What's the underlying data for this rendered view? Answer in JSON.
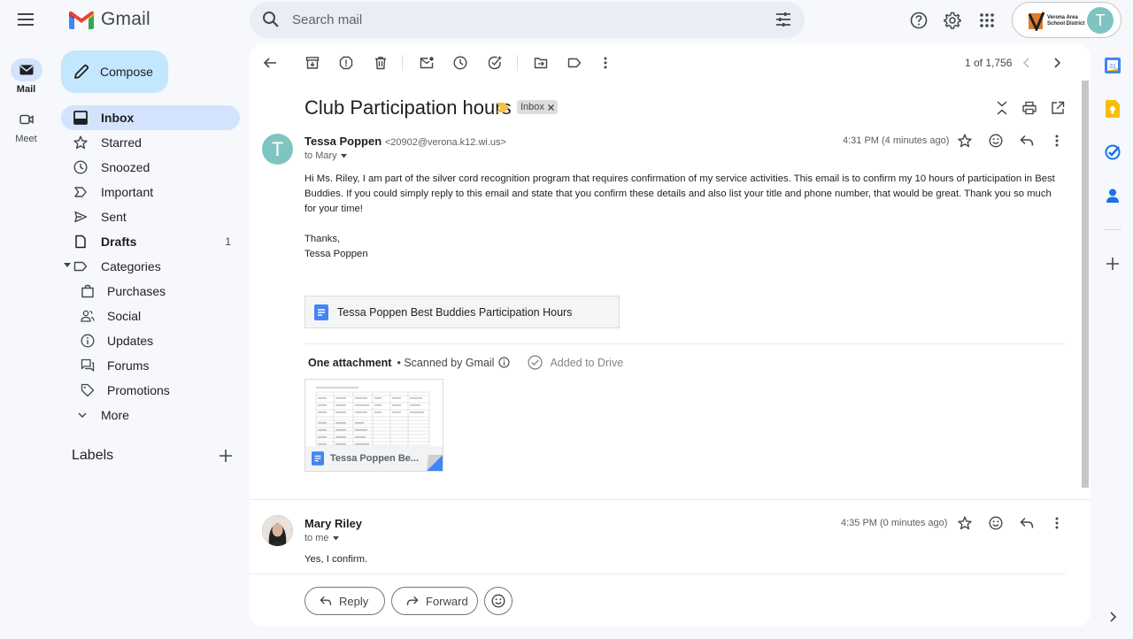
{
  "app": {
    "name": "Gmail"
  },
  "rail": {
    "mail_label": "Mail",
    "meet_label": "Meet"
  },
  "compose": {
    "label": "Compose"
  },
  "search": {
    "placeholder": "Search mail"
  },
  "account": {
    "org_name_line1": "Verona Area",
    "org_name_line2": "School District",
    "initial": "T"
  },
  "nav": {
    "items": [
      {
        "label": "Inbox",
        "count": ""
      },
      {
        "label": "Starred",
        "count": ""
      },
      {
        "label": "Snoozed",
        "count": ""
      },
      {
        "label": "Important",
        "count": ""
      },
      {
        "label": "Sent",
        "count": ""
      },
      {
        "label": "Drafts",
        "count": "1"
      },
      {
        "label": "Categories",
        "count": ""
      },
      {
        "label": "Purchases",
        "count": ""
      },
      {
        "label": "Social",
        "count": ""
      },
      {
        "label": "Updates",
        "count": ""
      },
      {
        "label": "Forums",
        "count": ""
      },
      {
        "label": "Promotions",
        "count": ""
      },
      {
        "label": "More",
        "count": ""
      }
    ],
    "labels_header": "Labels"
  },
  "toolbar": {
    "pager": "1 of 1,756"
  },
  "thread": {
    "subject": "Club Participation hours",
    "label_chip": "Inbox",
    "messages": [
      {
        "initial": "T",
        "sender_name": "Tessa Poppen",
        "sender_email": "<20902@verona.k12.wi.us>",
        "to": "to Mary",
        "time": "4:31 PM (4 minutes ago)",
        "body": "Hi Ms. Riley, I am part of the silver cord recognition program that requires confirmation of my service activities. This email is to confirm my 10 hours of participation in Best Buddies. If you could simply reply to this email and state that you confirm these details and also list your title and phone number, that would be great. Thank you so much for your time!",
        "sign_off": "Thanks,",
        "signature": "Tessa Poppen",
        "doc_chip": "Tessa Poppen Best Buddies Participation Hours",
        "attachments_header": "One attachment",
        "scanned": "Scanned by Gmail",
        "added_to_drive": "Added to Drive",
        "attachment_name": "Tessa Poppen Be..."
      },
      {
        "sender_name": "Mary Riley",
        "to": "to me",
        "time": "4:35 PM (0 minutes ago)",
        "body": "Yes, I confirm."
      }
    ],
    "reply_label": "Reply",
    "forward_label": "Forward"
  },
  "colors": {
    "accent_bg": "#d3e3fd",
    "compose_bg": "#c2e7ff",
    "avatar_teal": "#7fc4c1"
  }
}
